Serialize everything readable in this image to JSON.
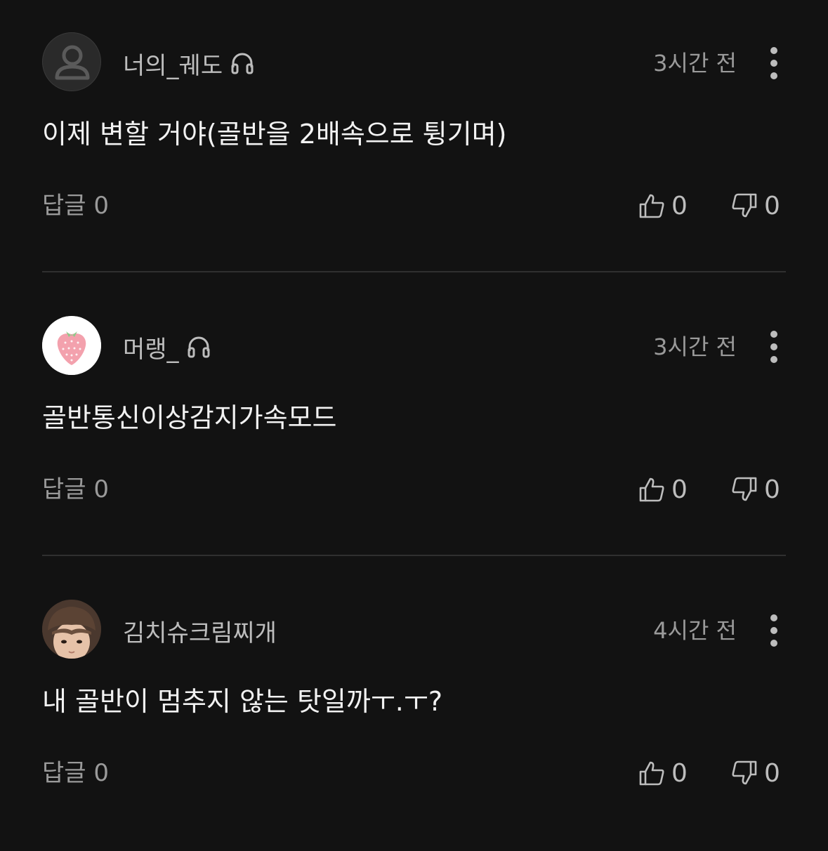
{
  "colors": {
    "background": "#121212",
    "username": "#bdbdbd",
    "secondary_text": "#9a9a9a",
    "divider": "#2f2f2f"
  },
  "comments": [
    {
      "username": "너의_궤도",
      "badge_icon": "headphone-icon",
      "time": "3시간 전",
      "text": "이제 변할 거야(골반을 2배속으로 튕기며)",
      "reply_label": "답글 0",
      "likes": "0",
      "dislikes": "0",
      "avatar": "default-user-icon"
    },
    {
      "username": "머랭_",
      "badge_icon": "headphone-icon",
      "time": "3시간 전",
      "text": "골반통신이상감지가속모드",
      "reply_label": "답글 0",
      "likes": "0",
      "dislikes": "0",
      "avatar": "strawberry"
    },
    {
      "username": "김치슈크림찌개",
      "time": "4시간 전",
      "text": "내 골반이 멈추지 않는 탓일까ㅜ.ㅜ?",
      "reply_label": "답글 0",
      "likes": "0",
      "dislikes": "0",
      "avatar": "person-photo"
    }
  ]
}
